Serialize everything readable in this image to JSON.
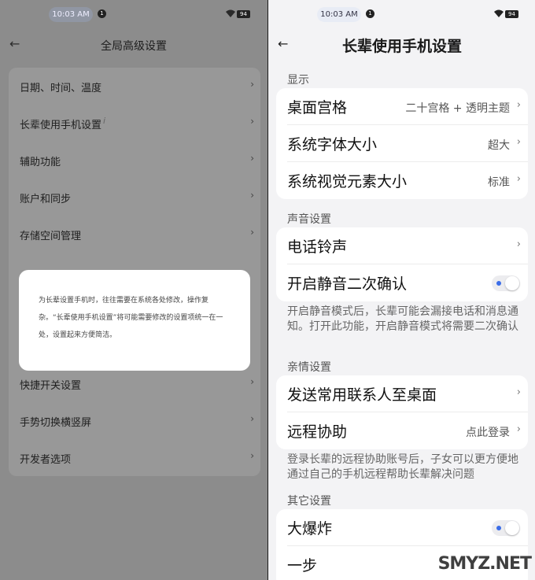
{
  "status": {
    "time": "10:03 AM",
    "notification_count": "1",
    "battery": "94"
  },
  "left": {
    "title": "全局高级设置",
    "items": [
      {
        "label": "日期、时间、温度"
      },
      {
        "label": "长辈使用手机设置",
        "info": "i"
      },
      {
        "label": "辅助功能"
      },
      {
        "label": "账户和同步"
      },
      {
        "label": "存储空间管理"
      },
      {
        "label": "快捷开关设置"
      },
      {
        "label": "手势切换横竖屏"
      },
      {
        "label": "开发者选项"
      }
    ],
    "dialog_text": "为长辈设置手机时，往往需要在系统各处修改，操作复杂。“长辈使用手机设置”将可能需要修改的设置项统一在一处，设置起来方便简洁。"
  },
  "right": {
    "title": "长辈使用手机设置",
    "sections": {
      "display": {
        "title": "显示",
        "rows": [
          {
            "label": "桌面宫格",
            "value": "二十宫格 + 透明主题"
          },
          {
            "label": "系统字体大小",
            "value": "超大"
          },
          {
            "label": "系统视觉元素大小",
            "value": "标准"
          }
        ]
      },
      "sound": {
        "title": "声音设置",
        "rows": [
          {
            "label": "电话铃声"
          },
          {
            "label": "开启静音二次确认",
            "toggle": true
          }
        ],
        "note": "开启静音模式后，长辈可能会漏接电话和消息通知。打开此功能，开启静音模式将需要二次确认"
      },
      "family": {
        "title": "亲情设置",
        "rows": [
          {
            "label": "发送常用联系人至桌面"
          },
          {
            "label": "远程协助",
            "value": "点此登录"
          }
        ],
        "note": "登录长辈的远程协助账号后，子女可以更方便地通过自己的手机远程帮助长辈解决问题"
      },
      "other": {
        "title": "其它设置",
        "rows": [
          {
            "label": "大爆炸",
            "toggle": true
          },
          {
            "label": "一步"
          }
        ]
      }
    }
  },
  "watermark": "SMYZ.NET",
  "icons": {
    "back": "back-arrow-icon",
    "chevron": "chevron-right-icon",
    "wifi": "wifi-icon",
    "battery": "battery-icon"
  },
  "colors": {
    "toggle_dot": "#3b6de8",
    "dim_overlay": "#8c8c8c",
    "card": "#ffffff"
  }
}
